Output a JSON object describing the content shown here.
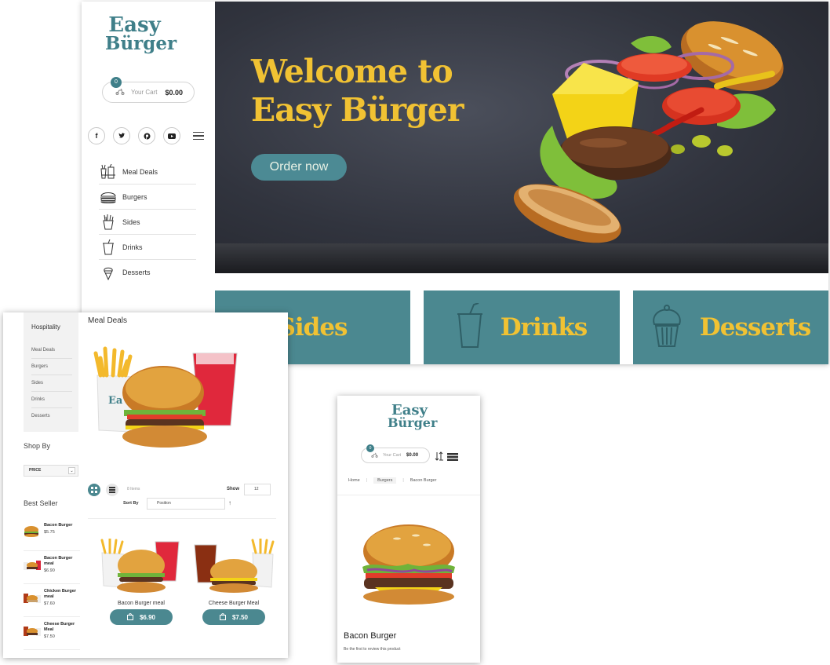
{
  "brand": {
    "logo_line1": "Easy",
    "logo_line2": "Bürger",
    "accent_color": "#4b8890",
    "highlight_color": "#f1c233"
  },
  "cart": {
    "count": "0",
    "label": "Your Cart",
    "total": "$0.00"
  },
  "social": [
    "f",
    "t",
    "p",
    "y"
  ],
  "menu": [
    {
      "label": "Meal Deals",
      "icon": "meal-deal-icon"
    },
    {
      "label": "Burgers",
      "icon": "burger-icon"
    },
    {
      "label": "Sides",
      "icon": "fries-icon"
    },
    {
      "label": "Drinks",
      "icon": "drink-cup-icon"
    },
    {
      "label": "Desserts",
      "icon": "ice-cream-icon"
    }
  ],
  "hero": {
    "title_line1": "Welcome to",
    "title_line2": "Easy Bürger",
    "cta": "Order now"
  },
  "tiles": [
    {
      "label": "Sides"
    },
    {
      "label": "Drinks",
      "icon": "drink-cup-icon"
    },
    {
      "label": "Desserts",
      "icon": "cupcake-icon"
    }
  ],
  "category_page": {
    "sidebar_title": "Hospitality",
    "sidebar_links": [
      "Meal Deals",
      "Burgers",
      "Sides",
      "Drinks",
      "Desserts"
    ],
    "page_title": "Meal Deals",
    "shop_by": "Shop By",
    "price_filter": "PRICE",
    "best_seller_title": "Best Seller",
    "best_sellers": [
      {
        "name": "Bacon Burger",
        "price": "$5.75"
      },
      {
        "name": "Bacon Burger meal",
        "price": "$6.90"
      },
      {
        "name": "Chicken Burger meal",
        "price": "$7.60"
      },
      {
        "name": "Cheese Burger Meal",
        "price": "$7.50"
      }
    ],
    "items_count": "8 Items",
    "show_label": "Show",
    "show_value": "12",
    "sort_label": "Sort By",
    "sort_value": "Position",
    "products": [
      {
        "name": "Bacon Burger meal",
        "price": "$6.90"
      },
      {
        "name": "Cheese Burger Meal",
        "price": "$7.50"
      }
    ]
  },
  "product_page": {
    "breadcrumb": [
      "Home",
      "Burgers",
      "Bacon Burger"
    ],
    "title": "Bacon Burger",
    "review_text": "Be the first to review this product"
  }
}
